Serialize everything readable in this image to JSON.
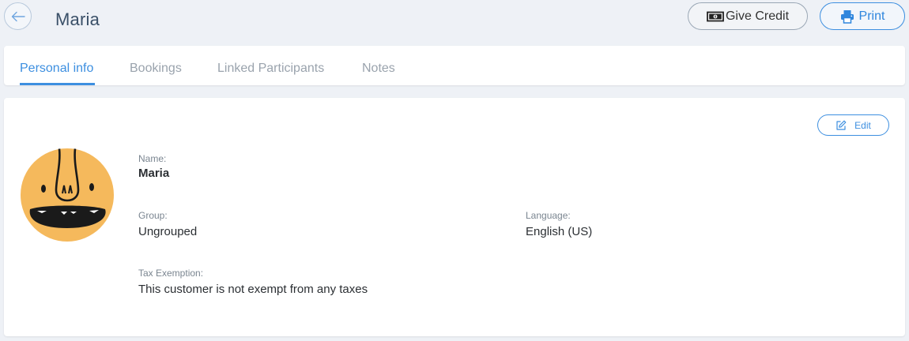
{
  "header": {
    "title": "Maria",
    "give_credit_label": "Give Credit",
    "print_label": "Print"
  },
  "tabs": [
    {
      "label": "Personal info",
      "active": true
    },
    {
      "label": "Bookings",
      "active": false
    },
    {
      "label": "Linked Participants",
      "active": false
    },
    {
      "label": "Notes",
      "active": false
    }
  ],
  "profile": {
    "edit_label": "Edit",
    "fields": {
      "name_label": "Name:",
      "name_value": "Maria",
      "group_label": "Group:",
      "group_value": "Ungrouped",
      "language_label": "Language:",
      "language_value": "English (US)",
      "tax_label": "Tax Exemption:",
      "tax_value": "This customer is not exempt from any taxes"
    }
  },
  "icons": {
    "back": "arrow-left-icon",
    "credit": "banknote-icon",
    "print": "printer-icon",
    "edit": "pencil-square-icon",
    "avatar": "cartoon-face-avatar"
  },
  "colors": {
    "accent": "#3d8fe0",
    "background": "#eef1f6",
    "avatar": "#f5b95c"
  }
}
